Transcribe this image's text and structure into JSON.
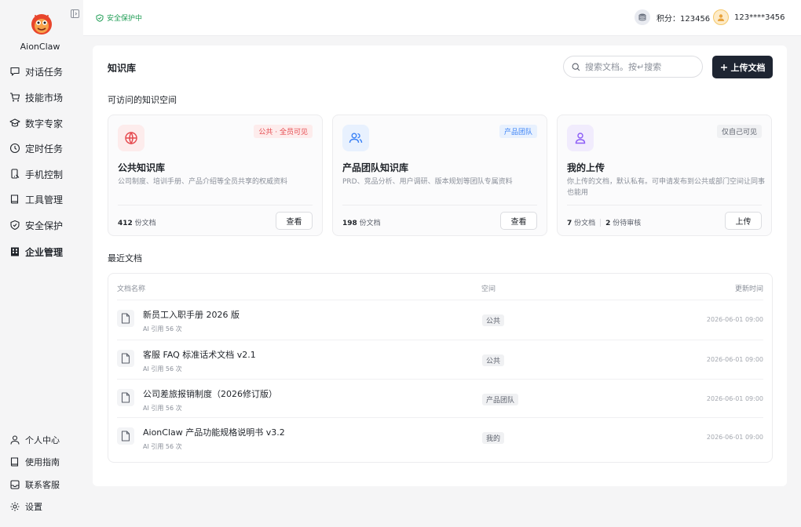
{
  "app": {
    "name": "AionClaw"
  },
  "sidebar": {
    "items": [
      {
        "label": "对话任务",
        "icon": "chat-icon"
      },
      {
        "label": "技能市场",
        "icon": "cart-icon"
      },
      {
        "label": "数字专家",
        "icon": "graduation-cap-icon"
      },
      {
        "label": "定时任务",
        "icon": "clock-icon"
      },
      {
        "label": "手机控制",
        "icon": "phone-icon"
      },
      {
        "label": "工具管理",
        "icon": "book-icon"
      },
      {
        "label": "安全保护",
        "icon": "shield-icon"
      },
      {
        "label": "企业管理",
        "icon": "building-icon",
        "active": true
      }
    ],
    "bottom_items": [
      {
        "label": "个人中心",
        "icon": "user-icon"
      },
      {
        "label": "使用指南",
        "icon": "book-icon"
      },
      {
        "label": "联系客服",
        "icon": "inbox-icon"
      },
      {
        "label": "设置",
        "icon": "gear-icon"
      }
    ]
  },
  "header": {
    "security_status": "安全保护中",
    "points_label": "积分：123456",
    "user_phone": "123****3456"
  },
  "main": {
    "title": "知识库",
    "search_placeholder": "搜索文档。按↵搜索",
    "upload_button": "上传文档",
    "spaces_section_label": "可访问的知识空间",
    "recent_section_label": "最近文档",
    "spaces": [
      {
        "title": "公共知识库",
        "badge": "公共 · 全员可见",
        "description": "公司制度、培训手册、产品介绍等全员共享的权威资料",
        "stat_count": "412",
        "stat_label": "份文档",
        "button": "查看",
        "icon": "globe-icon",
        "accent": "#e5484d"
      },
      {
        "title": "产品团队知识库",
        "badge": "产品团队",
        "description": "PRD、竞品分析、用户调研、版本规划等团队专属资料",
        "stat_count": "198",
        "stat_label": "份文档",
        "button": "查看",
        "icon": "users-icon",
        "accent": "#3b82f6"
      },
      {
        "title": "我的上传",
        "badge": "仅自己可见",
        "description": "你上传的文档，默认私有。可申请发布到公共或部门空间让同事也能用",
        "stat_count": "7",
        "stat_label": "份文档",
        "stat2_count": "2",
        "stat2_label": "份待审核",
        "button": "上传",
        "icon": "user-icon",
        "accent": "#8b5cf6"
      }
    ],
    "table": {
      "headers": {
        "name": "文档名称",
        "space": "空间",
        "updated": "更新时间"
      },
      "rows": [
        {
          "name": "新员工入职手册 2026 版",
          "sub": "AI 引用 56 次",
          "space": "公共",
          "updated": "2026-06-01 09:00"
        },
        {
          "name": "客服 FAQ 标准话术文档 v2.1",
          "sub": "AI 引用 56 次",
          "space": "公共",
          "updated": "2026-06-01 09:00"
        },
        {
          "name": "公司差旅报销制度（2026修订版）",
          "sub": "AI 引用 56 次",
          "space": "产品团队",
          "updated": "2026-06-01 09:00"
        },
        {
          "name": "AionClaw 产品功能规格说明书 v3.2",
          "sub": "AI 引用 56 次",
          "space": "我的",
          "updated": "2026-06-01 09:00"
        }
      ]
    }
  },
  "colors": {
    "brand_dark": "#1e2532",
    "secure_green": "#1f9d55",
    "badge_red": "#e5484d",
    "badge_blue": "#3b82f6",
    "badge_gray": "#5b606b"
  }
}
